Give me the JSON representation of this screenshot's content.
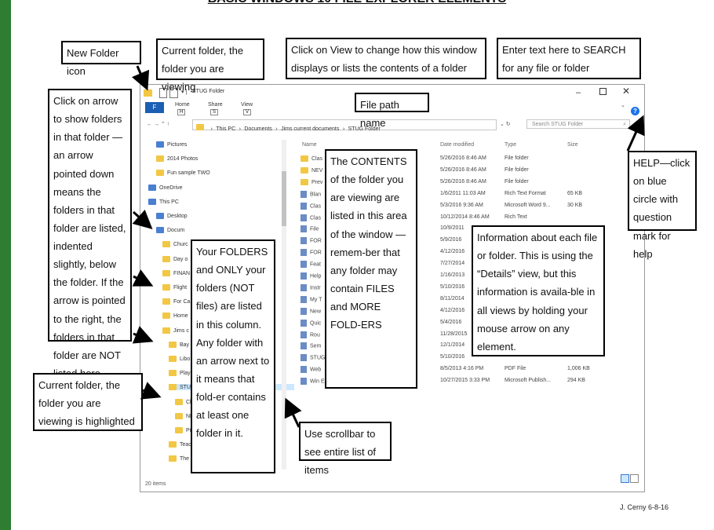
{
  "page": {
    "title": "BASIC WINDOWS 10 FILE EXPLORER ELEMENTS",
    "credit": "J. Cerny  6-8-16"
  },
  "window": {
    "title": "STUG Folder",
    "ribbon_tabs": [
      "Home",
      "Share",
      "View"
    ],
    "file_tab": "F",
    "ribbon_keys": [
      "H",
      "S",
      "V"
    ],
    "path": [
      "This PC",
      "Documents",
      "Jims current documents",
      "STUG Folder"
    ],
    "search_placeholder": "Search STUG Folder",
    "status": "20 items",
    "columns": {
      "name": "Name",
      "date": "Date modified",
      "type": "Type",
      "size": "Size"
    }
  },
  "nav_pane": [
    {
      "label": "Pictures",
      "icon": "pictures-icon"
    },
    {
      "label": "2014 Photos",
      "icon": "folder-icon"
    },
    {
      "label": "Fun sample TWO",
      "icon": "folder-icon"
    },
    {
      "label": "OneDrive",
      "icon": "onedrive-icon"
    },
    {
      "label": "This PC",
      "icon": "pc-icon"
    },
    {
      "label": "Desktop",
      "icon": "desktop-icon"
    },
    {
      "label": "Docum",
      "icon": "documents-icon"
    },
    {
      "label": "Churc",
      "icon": "folder-icon"
    },
    {
      "label": "Day o",
      "icon": "folder-icon"
    },
    {
      "label": "FINAN",
      "icon": "folder-icon"
    },
    {
      "label": "Flight",
      "icon": "folder-icon"
    },
    {
      "label": "For Ca",
      "icon": "folder-icon"
    },
    {
      "label": "Home",
      "icon": "folder-icon"
    },
    {
      "label": "Jims c",
      "icon": "folder-icon"
    },
    {
      "label": "Bay",
      "icon": "folder-icon"
    },
    {
      "label": "Libo",
      "icon": "folder-icon"
    },
    {
      "label": "Play",
      "icon": "folder-icon"
    },
    {
      "label": "STU",
      "icon": "folder-icon"
    },
    {
      "label": "Cl",
      "icon": "folder-icon"
    },
    {
      "label": "NE",
      "icon": "folder-icon"
    },
    {
      "label": "Pre",
      "icon": "folder-icon"
    },
    {
      "label": "Teac",
      "icon": "folder-icon"
    },
    {
      "label": "The",
      "icon": "folder-icon"
    }
  ],
  "files": [
    {
      "name": "Clas",
      "date": "5/26/2016 8:46 AM",
      "type": "File folder",
      "size": ""
    },
    {
      "name": "NEV",
      "date": "5/26/2016 8:46 AM",
      "type": "File folder",
      "size": ""
    },
    {
      "name": "Prev",
      "date": "5/26/2016 8:46 AM",
      "type": "File folder",
      "size": ""
    },
    {
      "name": "Blan",
      "date": "1/6/2011 11:03 AM",
      "type": "Rich Text Format",
      "size": "65 KB"
    },
    {
      "name": "Clas",
      "date": "5/3/2016 9:36 AM",
      "type": "Microsoft Word 9...",
      "size": "30 KB"
    },
    {
      "name": "Clas",
      "date": "10/12/2014 8:46 AM",
      "type": "Rich Text",
      "size": ""
    },
    {
      "name": "File",
      "date": "10/9/2011",
      "type": "",
      "size": ""
    },
    {
      "name": "FOR",
      "date": "5/9/2016",
      "type": "",
      "size": ""
    },
    {
      "name": "FOR",
      "date": "4/12/2016",
      "type": "",
      "size": ""
    },
    {
      "name": "Feat",
      "date": "7/27/2014",
      "type": "",
      "size": ""
    },
    {
      "name": "Help",
      "date": "1/16/2013",
      "type": "",
      "size": ""
    },
    {
      "name": "Instr",
      "date": "5/10/2016",
      "type": "",
      "size": ""
    },
    {
      "name": "My T",
      "date": "8/11/2014",
      "type": "",
      "size": ""
    },
    {
      "name": "New",
      "date": "4/12/2016",
      "type": "",
      "size": ""
    },
    {
      "name": "Quic",
      "date": "5/4/2016",
      "type": "",
      "size": ""
    },
    {
      "name": "Rou",
      "date": "11/28/2015",
      "type": "",
      "size": ""
    },
    {
      "name": "Sem",
      "date": "12/1/2014",
      "type": "",
      "size": ""
    },
    {
      "name": "STUG",
      "date": "5/10/2016",
      "type": "",
      "size": ""
    },
    {
      "name": "Web",
      "date": "8/5/2013 4:16 PM",
      "type": "PDF File",
      "size": "1,006 KB"
    },
    {
      "name": "Win Explorer Screenshot w arrows",
      "date": "10/27/2015 3:33 PM",
      "type": "Microsoft Publish...",
      "size": "294 KB"
    }
  ],
  "callouts": {
    "new_folder": "New Folder icon",
    "current_folder": "Current folder, the folder you are viewing",
    "view": "Click on View to change how this window displays or lists the contents of a folder",
    "search": "Enter text here to SEARCH for any file or folder",
    "file_path": "File path name",
    "arrow_help": "Click on arrow to show folders in that folder — an arrow pointed down means the folders in that folder are listed, indented slightly, below the folder. If the arrow is pointed to the right, the folders in that folder are NOT listed here.",
    "contents": "The CONTENTS of the folder you are viewing are listed in this area of the window — remem-ber that any folder may contain FILES and MORE FOLD-ERS",
    "information": "Information about each file or folder. This is using the “Details” view, but this information is availa-ble in all views by holding your mouse arrow on any element.",
    "help": "HELP—click on blue circle with question mark for help",
    "your_folders": "Your FOLDERS and ONLY your folders (NOT files) are listed in this column. Any folder with an arrow next to it means that fold-er contains at least one folder in it.",
    "highlighted": "Current folder, the folder you are viewing is highlighted",
    "scrollbar": "Use scrollbar to see entire list of items"
  },
  "colors": {
    "accent": "#2e7d32",
    "folder": "#f2c744",
    "help": "#1a73e8",
    "selected": "#cce8ff"
  }
}
